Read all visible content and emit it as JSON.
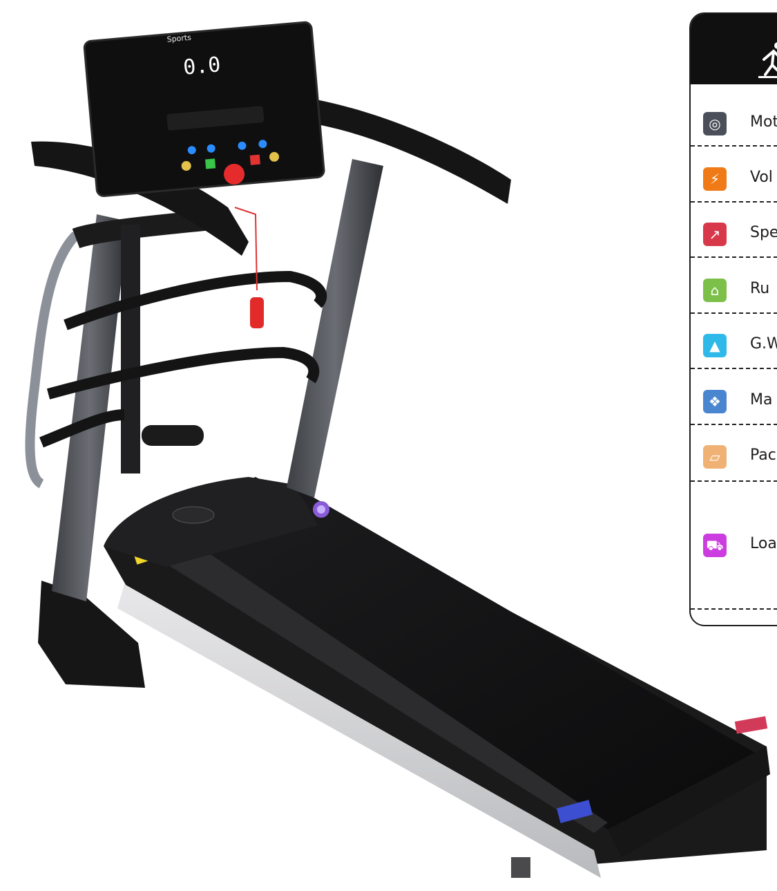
{
  "console": {
    "brand": "Sports",
    "speed_readout": "0.0"
  },
  "spec_card": {
    "items": [
      {
        "label": "Mot",
        "icon": "motor-icon",
        "color": "#4a4f59"
      },
      {
        "label": "Vol",
        "icon": "voltage-bolt-icon",
        "color": "#f07b16"
      },
      {
        "label": "Spe",
        "icon": "speed-arrow-icon",
        "color": "#d8394a"
      },
      {
        "label": "Ru",
        "icon": "running-area-icon",
        "color": "#7cc04a"
      },
      {
        "label": "G.W",
        "icon": "weight-icon",
        "color": "#2fb9e8"
      },
      {
        "label": "Ma",
        "icon": "layers-icon",
        "color": "#4a86d0"
      },
      {
        "label": "Pac",
        "icon": "package-icon",
        "color": "#f0b274"
      },
      {
        "label": "Loa",
        "icon": "delivery-truck-icon",
        "color": "#cc3de0"
      }
    ]
  }
}
